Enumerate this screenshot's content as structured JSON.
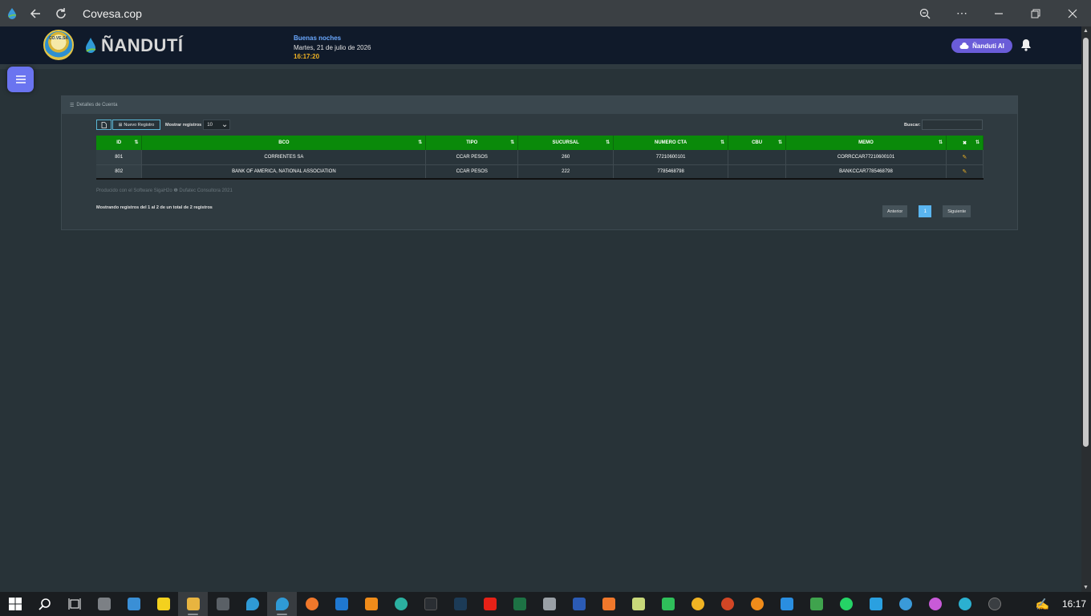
{
  "browser": {
    "site_title": "Covesa.cop",
    "controls": [
      "zoom-icon",
      "more-icon",
      "minimize-icon",
      "restore-icon",
      "close-icon"
    ]
  },
  "header": {
    "logo_text": "CO.VE.SA",
    "brand": "ÑANDUTÍ",
    "greeting": "Buenas noches",
    "date": "Martes, 21 de julio de 2026",
    "time": "16:17:20",
    "ai_button": "Ñanduti AI",
    "accent": "#6a74f0"
  },
  "panel": {
    "title": "Detalles de Cuenta",
    "new_button": "Nuevo Registro",
    "show_label": "Mostrar registros",
    "page_size": "10",
    "search_label": "Buscar:",
    "search_value": "",
    "columns": [
      "ID",
      "BCO",
      "TIPO",
      "SUCURSAL",
      "NUMERO CTA",
      "CBU",
      "MEMO",
      ""
    ],
    "rows": [
      {
        "id": "801",
        "bco": "CORRIENTES SA",
        "tipo": "CCAR PESOS",
        "sucursal": "260",
        "numero_cta": "77210600101",
        "cbu": "",
        "memo": "CORRCCAR77210600101"
      },
      {
        "id": "802",
        "bco": "BANK OF AMERICA, NATIONAL ASSOCIATION",
        "tipo": "CCAR PESOS",
        "sucursal": "222",
        "numero_cta": "7785468798",
        "cbu": "",
        "memo": "BANKCCAR7785468798"
      }
    ],
    "footer_note": "Producido con el Software SigaH2o  ❶  Dufatec Consultora 2021",
    "info": "Mostrando registros del 1 al 2 de un total de 2 registros",
    "prev": "Anterior",
    "page": "1",
    "next": "Siguiente",
    "header_color": "#0a8a0a"
  },
  "taskbar": {
    "clock": "16:17"
  }
}
